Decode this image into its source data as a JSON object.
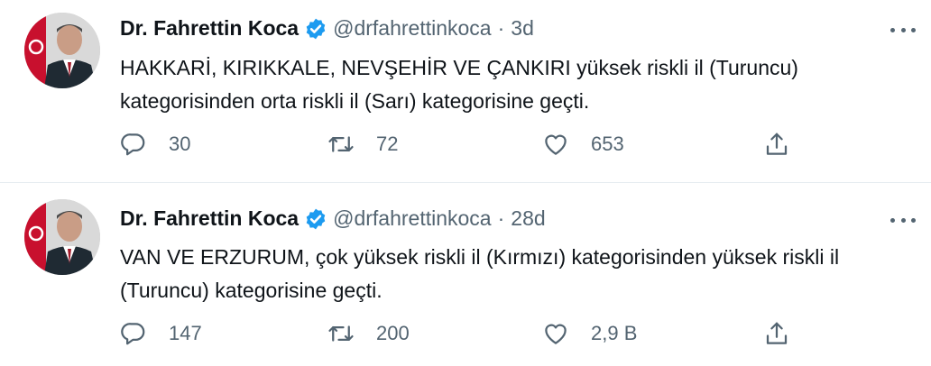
{
  "tweets": [
    {
      "name": "Dr. Fahrettin Koca",
      "handle": "@drfahrettinkoca",
      "separator": "·",
      "time": "3d",
      "text": "HAKKARİ, KIRIKKALE, NEVŞEHİR VE ÇANKIRI yüksek riskli il (Turuncu) kategorisinden orta riskli il (Sarı) kategorisine geçti.",
      "replies": "30",
      "retweets": "72",
      "likes": "653"
    },
    {
      "name": "Dr. Fahrettin Koca",
      "handle": "@drfahrettinkoca",
      "separator": "·",
      "time": "28d",
      "text": "VAN VE ERZURUM, çok yüksek riskli il (Kırmızı) kategorisinden yüksek riskli il (Turuncu) kategorisine geçti.",
      "replies": "147",
      "retweets": "200",
      "likes": "2,9 B"
    }
  ],
  "icons": {
    "verified": "verified-badge-icon",
    "more": "more-dots-icon",
    "reply": "reply-icon",
    "retweet": "retweet-icon",
    "like": "heart-icon",
    "share": "share-icon"
  },
  "colors": {
    "verified_blue": "#1d9bf0",
    "secondary_text": "#536471",
    "primary_text": "#0f1419",
    "divider": "#e6ecf0"
  }
}
